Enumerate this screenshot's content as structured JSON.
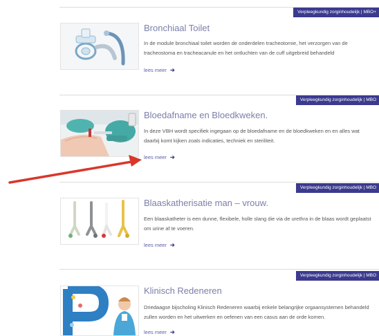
{
  "courses": [
    {
      "badge": "Verpleegkundig zorginhoudelijk | MBO+",
      "title": "Bronchiaal Toilet",
      "description": "In de module bronchiaal toilet worden de onderdelen tracheotomie, het verzorgen van de tracheostoma en tracheacanule en het ontluchten van de cuff uitgebreid behandeld",
      "more": "lees meer",
      "image": "tracheostomy-cannule-photo"
    },
    {
      "badge": "Verpleegkundig zorginhoudelijk | MBO",
      "title": "Bloedafname en Bloedkweken.",
      "description": "In deze VBH wordt specifiek ingegaan op de bloedafname en de bloedkweken en en alles wat daarbij komt kijken zoals indicaties, techniek en steriliteit.",
      "more": "lees meer",
      "image": "blood-draw-photo"
    },
    {
      "badge": "Verpleegkundig zorginhoudelijk | MBO",
      "title": "Blaaskatherisatie man – vrouw.",
      "description": "Een blaaskatheter is een dunne, flexibele, holle slang die via de urethra in de blaas wordt geplaatst om urine af te voeren.",
      "more": "lees meer",
      "image": "catheters-photo"
    },
    {
      "badge": "Verpleegkundig zorginhoudelijk | MBO",
      "title": "Klinisch Redeneren",
      "description": "Driedaagse bijscholing Klinisch Redeneren waarbij enkele belangrijke orgaansystemen behandeld zullen worden en het uitwerken en oefenen van een casus aan de orde komen.",
      "more": "lees meer",
      "image": "clinical-reasoning-poster"
    }
  ],
  "colors": {
    "badge": "#3b3a8f",
    "title": "#7a7fa8",
    "link": "#5a5fa6",
    "pointer_arrow": "#d9372b"
  }
}
